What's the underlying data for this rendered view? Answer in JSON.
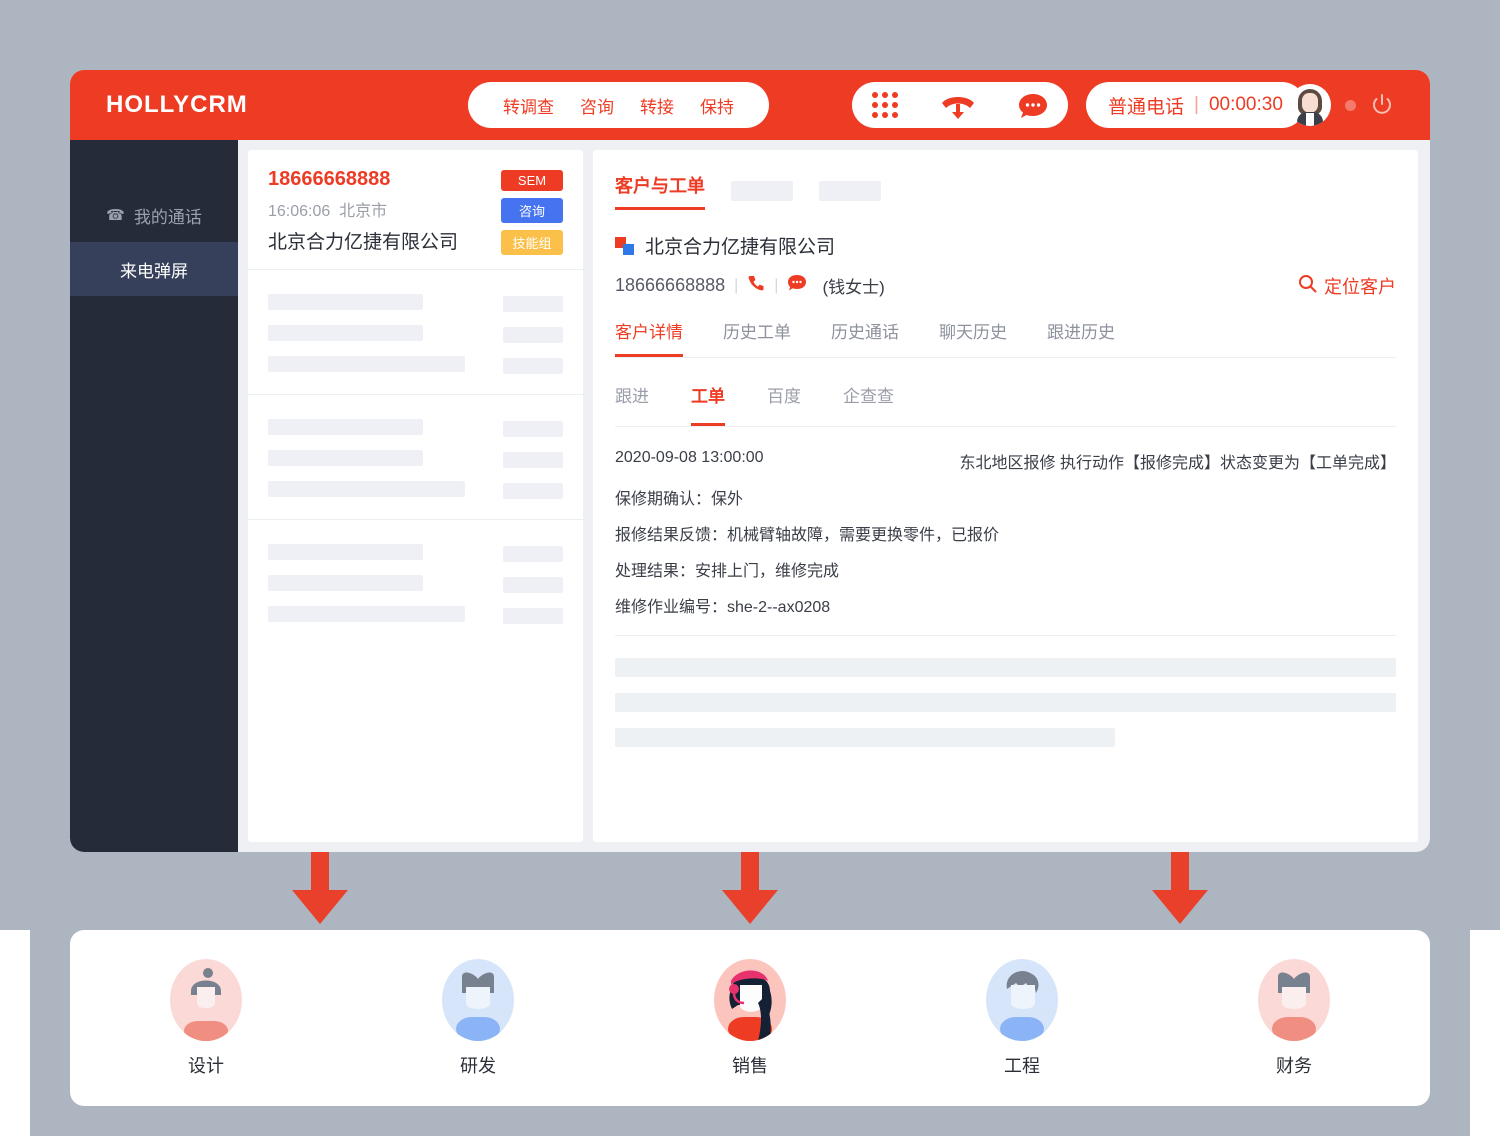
{
  "header": {
    "brand": "HOLLYCRM",
    "actions": [
      "转调查",
      "咨询",
      "转接",
      "保持"
    ],
    "icons": [
      "keypad-icon",
      "hangup-icon",
      "chat-icon"
    ],
    "call_status": "普通电话",
    "call_separator": "|",
    "call_timer": "00:00:30",
    "power_icon": "power-icon",
    "avatar": "agent-avatar"
  },
  "sidebar": {
    "items": [
      {
        "label": "我的通话",
        "icon": "phone-icon",
        "active": false
      },
      {
        "label": "来电弹屏",
        "icon": "",
        "active": true
      }
    ]
  },
  "call_card": {
    "number": "18666668888",
    "time": "16:06:06",
    "city": "北京市",
    "company": "北京合力亿捷有限公司",
    "tags": [
      {
        "label": "SEM",
        "color": "#ee3b24"
      },
      {
        "label": "咨询",
        "color": "#4673f0"
      },
      {
        "label": "技能组",
        "color": "#fbc04a"
      }
    ],
    "placeholder_blocks": 3
  },
  "detail": {
    "section_tabs": [
      {
        "label": "客户与工单",
        "active": true
      },
      {
        "label": "",
        "active": false,
        "ghost": true
      },
      {
        "label": "",
        "active": false,
        "ghost": true
      }
    ],
    "customer_name": "北京合力亿捷有限公司",
    "customer_logo": "company-logo-icon",
    "phone": "18666668888",
    "phone_icon": "phone-icon",
    "chat_icon": "chat-bubble-icon",
    "contact": "(钱女士)",
    "locate_button": "定位客户",
    "locate_icon": "search-icon",
    "main_tabs": [
      {
        "label": "客户详情",
        "active": true
      },
      {
        "label": "历史工单",
        "active": false
      },
      {
        "label": "历史通话",
        "active": false
      },
      {
        "label": "聊天历史",
        "active": false
      },
      {
        "label": "跟进历史",
        "active": false
      }
    ],
    "sub_tabs": [
      {
        "label": "跟进",
        "active": false
      },
      {
        "label": "工单",
        "active": true
      },
      {
        "label": "百度",
        "active": false
      },
      {
        "label": "企查查",
        "active": false
      }
    ],
    "ticket": {
      "timestamp": "2020-09-08 13:00:00",
      "action": "东北地区报修 执行动作【报修完成】状态变更为【工单完成】",
      "lines": [
        "保修期确认：保外",
        "报修结果反馈：机械臂轴故障，需要更换零件，已报价",
        "处理结果：安排上门，维修完成",
        "维修作业编号：she-2--ax0208"
      ]
    }
  },
  "arrows": {
    "count": 3,
    "color": "#e8402a",
    "direction": "down"
  },
  "roles": [
    {
      "label": "设计",
      "bg": "#fbd9d6",
      "body": "#f08e82",
      "hair": "#78818f",
      "style": "bun"
    },
    {
      "label": "研发",
      "bg": "#d7e5fa",
      "body": "#8ab4f5",
      "hair": "#78818f",
      "style": "short"
    },
    {
      "label": "销售",
      "bg": "#fbc5bd",
      "body": "#ee3b24",
      "hair": "#142033",
      "style": "headset"
    },
    {
      "label": "工程",
      "bg": "#d7e5fa",
      "body": "#8ab4f5",
      "hair": "#78818f",
      "style": "spiky"
    },
    {
      "label": "财务",
      "bg": "#fbd9d6",
      "body": "#f08e82",
      "hair": "#78818f",
      "style": "short"
    }
  ],
  "colors": {
    "brand_red": "#ee3b24",
    "sidebar": "#262b3a",
    "sidebar_active": "#36405a",
    "page_bg": "#adb5c0",
    "skeleton": "#eef0f5"
  }
}
